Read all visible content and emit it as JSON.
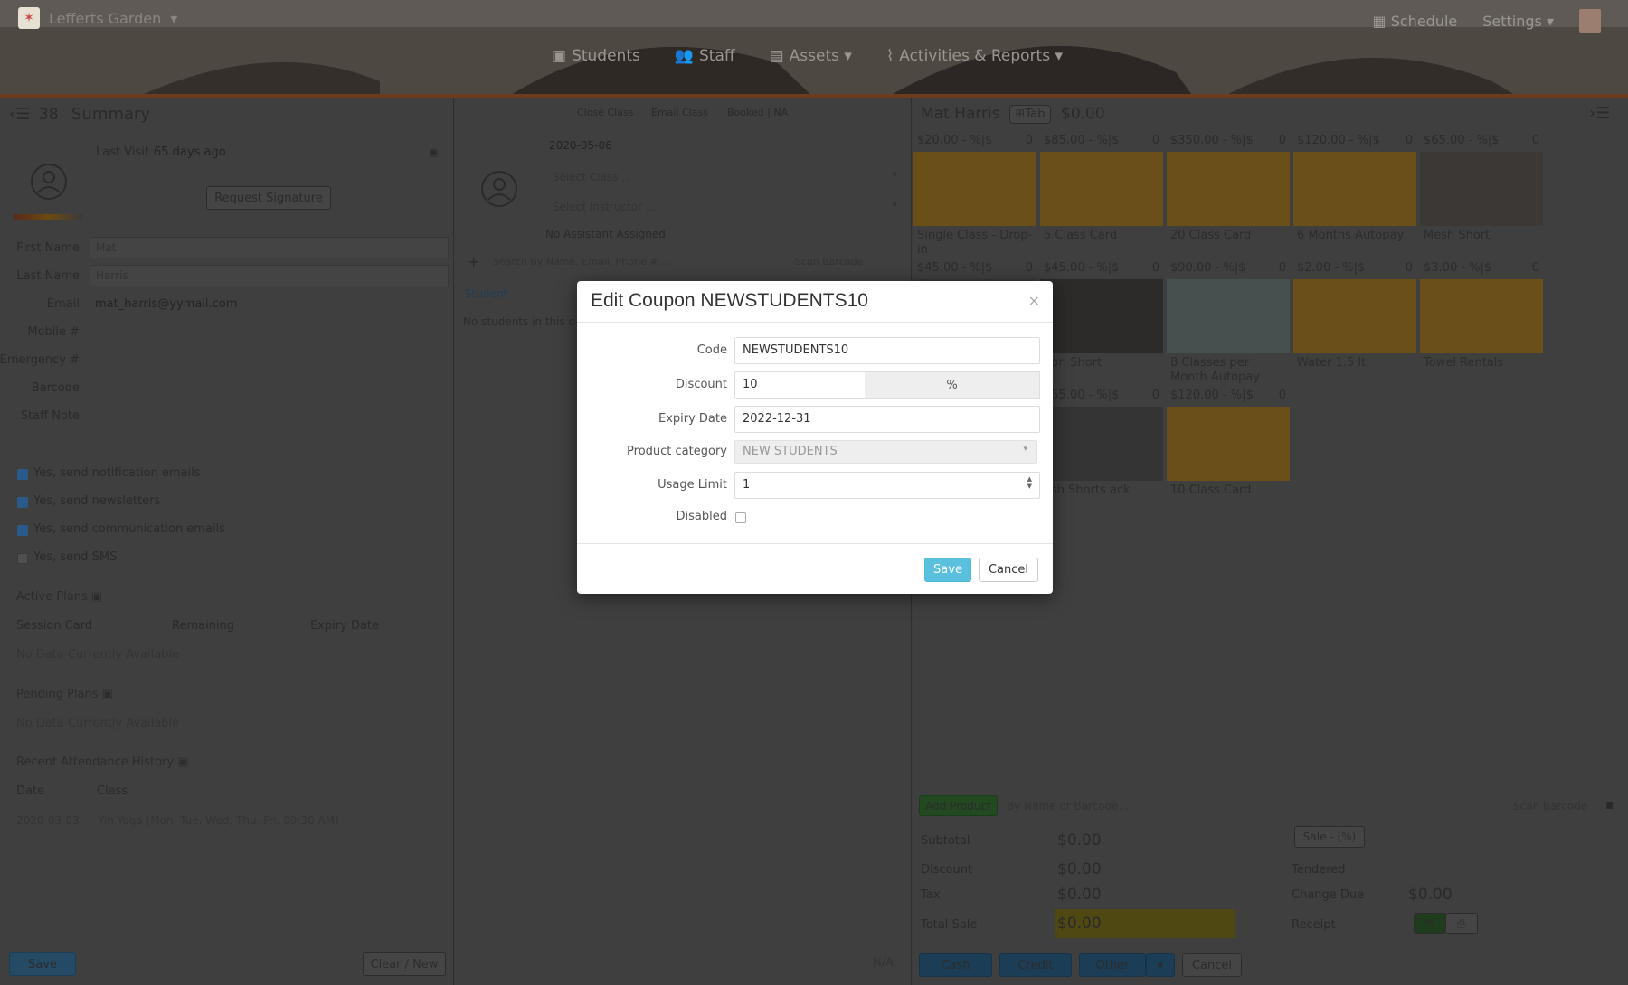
{
  "header": {
    "brand": "Lefferts Garden",
    "nav": [
      "Students",
      "Staff",
      "Assets",
      "Activities & Reports"
    ],
    "schedule": "Schedule",
    "settings": "Settings"
  },
  "left": {
    "count": "38",
    "title": "Summary",
    "last_visit_label": "Last Visit",
    "last_visit_value": "65 days ago",
    "request_signature": "Request Signature",
    "fields": [
      {
        "label": "First Name",
        "value": "Mat"
      },
      {
        "label": "Last Name",
        "value": "Harris"
      },
      {
        "label": "Email",
        "value": "mat_harris@yymail.com"
      },
      {
        "label": "Mobile #",
        "value": ""
      },
      {
        "label": "Emergency #",
        "value": ""
      },
      {
        "label": "Barcode",
        "value": ""
      },
      {
        "label": "Staff Note",
        "value": ""
      }
    ],
    "checkboxes": [
      {
        "label": "Yes, send notification emails",
        "checked": true
      },
      {
        "label": "Yes, send newsletters",
        "checked": true
      },
      {
        "label": "Yes, send communication emails",
        "checked": true
      },
      {
        "label": "Yes, send SMS",
        "checked": false
      }
    ],
    "active_plans": "Active Plans",
    "plan_cols": [
      "Session Card",
      "Remaining",
      "Expiry Date"
    ],
    "no_data": "No Data Currently Available",
    "pending_plans": "Pending Plans",
    "attendance": "Recent Attendance History",
    "att_cols": [
      "Date",
      "Class"
    ],
    "att_row": {
      "date": "2020-03-03",
      "class": "Yin Yoga (Mon, Tue, Wed, Thu, Fri, 09:30 AM)"
    },
    "save": "Save",
    "clear": "Clear / New"
  },
  "middle": {
    "tabs": [
      "Close Class",
      "Email Class",
      "Booked | NA"
    ],
    "date": "2020-05-06",
    "select_class": "Select Class ..",
    "select_instructor": "Select Instructor ...",
    "no_assistant": "No Assistant Assigned",
    "search_placeholder": "Search By Name, Email, Phone #...",
    "scan": "Scan Barcode",
    "student_col": "Student",
    "no_students": "No students in this c",
    "na": "N/A"
  },
  "right": {
    "customer": "Mat Harris",
    "tab": "Tab",
    "balance": "$0.00",
    "products": [
      {
        "price": "$20.00",
        "name": "Single Class - Drop-in"
      },
      {
        "price": "$85.00",
        "name": "5 Class Card"
      },
      {
        "price": "$350.00",
        "name": "20 Class Card"
      },
      {
        "price": "$120.00",
        "name": "6 Months Autopay"
      },
      {
        "price": "$65.00",
        "name": "Mesh Short"
      },
      {
        "price": "$45.00",
        "name": ""
      },
      {
        "price": "$45.00",
        "name": "apri Short"
      },
      {
        "price": "$90.00",
        "name": "8 Classes per Month Autopay"
      },
      {
        "price": "$2.00",
        "name": "Water 1.5 lt"
      },
      {
        "price": "$3.00",
        "name": "Towel Rentals"
      },
      {
        "price": "$55.00",
        "name": "esh Shorts ack"
      },
      {
        "price": "$120.00",
        "name": "10 Class Card"
      }
    ],
    "pct_label": "- %|$",
    "qty": "0",
    "add_product": "Add Product",
    "product_search": "By Name or Barcode...",
    "scan": "Scan Barcode",
    "subtotal_label": "Subtotal",
    "discount_label": "Discount",
    "tax_label": "Tax",
    "total_label": "Total Sale",
    "amount": "$0.00",
    "sale_btn": "Sale - (%)",
    "tendered": "Tendered",
    "change_due": "Change Due",
    "receipt": "Receipt",
    "cash": "Cash",
    "credit": "Credit",
    "other": "Other",
    "cancel": "Cancel"
  },
  "modal": {
    "title": "Edit Coupon NEWSTUDENTS10",
    "code_label": "Code",
    "code_value": "NEWSTUDENTS10",
    "discount_label": "Discount",
    "discount_value": "10",
    "discount_unit": "%",
    "expiry_label": "Expiry Date",
    "expiry_value": "2022-12-31",
    "category_label": "Product category",
    "category_value": "NEW STUDENTS",
    "usage_label": "Usage Limit",
    "usage_value": "1",
    "disabled_label": "Disabled",
    "save": "Save",
    "cancel": "Cancel"
  }
}
